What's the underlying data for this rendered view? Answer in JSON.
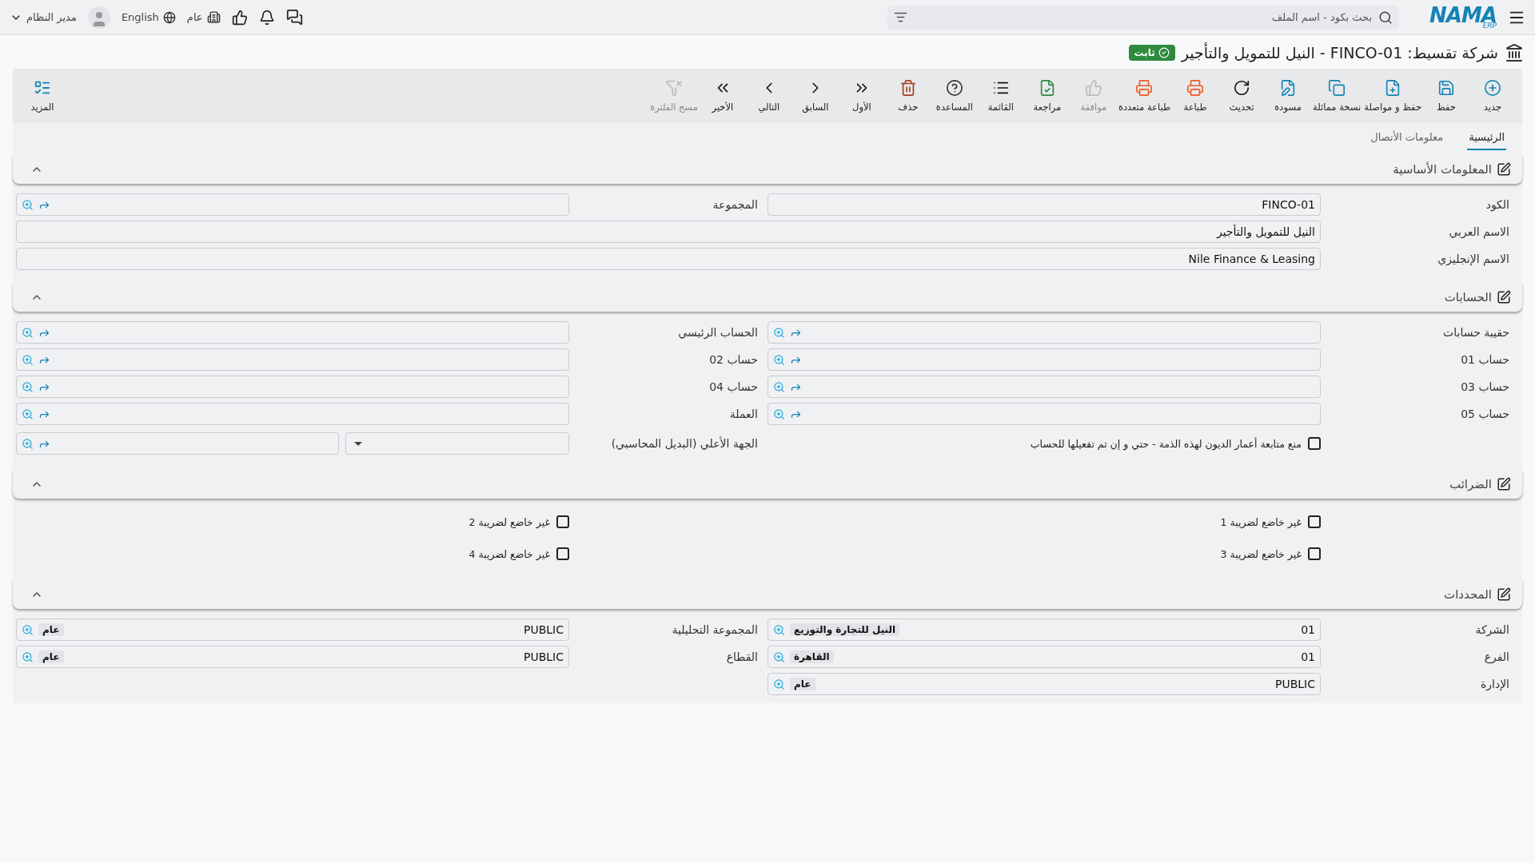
{
  "topbar": {
    "logo": {
      "name": "NAMA",
      "sub": "ERP"
    },
    "search": {
      "placeholder": "بحث بكود - اسم الملف"
    },
    "company": "عام",
    "language": "English",
    "user": "مدير النظام"
  },
  "title": {
    "text": "شركة تقسيط: FINCO-01 - النيل للتمويل والتأجير",
    "badge": "ثابت"
  },
  "toolbar": {
    "actions": [
      {
        "label": "جديد",
        "disabled": false
      },
      {
        "label": "حفظ",
        "disabled": false
      },
      {
        "label": "حفظ و مواصلة",
        "disabled": false
      },
      {
        "label": "نسخة مماثلة",
        "disabled": false
      },
      {
        "label": "مسودة",
        "disabled": false
      },
      {
        "label": "تحديث",
        "disabled": false
      },
      {
        "label": "طباعة",
        "disabled": false
      },
      {
        "label": "طباعة متعددة",
        "disabled": false
      },
      {
        "label": "موافقة",
        "disabled": true
      },
      {
        "label": "مراجعة",
        "disabled": false
      },
      {
        "label": "القائمة",
        "disabled": false
      },
      {
        "label": "المساعدة",
        "disabled": false
      },
      {
        "label": "حذف",
        "disabled": false
      },
      {
        "label": "الأول",
        "disabled": false
      },
      {
        "label": "السابق",
        "disabled": false
      },
      {
        "label": "التالي",
        "disabled": false
      },
      {
        "label": "الأخير",
        "disabled": false
      },
      {
        "label": "مسح الفلترة",
        "disabled": true
      }
    ],
    "more": "المزيد"
  },
  "tabs": [
    {
      "label": "الرئيسية",
      "selected": true
    },
    {
      "label": "معلومات الأتصال",
      "selected": false
    }
  ],
  "sections": [
    {
      "title": "المعلومات الأساسية",
      "expanded": true,
      "fields": [
        {
          "kind": "text",
          "label": "الكود",
          "value": "FINCO-01"
        },
        {
          "kind": "lookup",
          "label": "المجموعة"
        },
        {
          "kind": "wide",
          "label": "الاسم العربي",
          "value": "النيل للتمويل والتأجير"
        },
        {
          "kind": "wide",
          "label": "الاسم الإنجليزي",
          "value": "Nile Finance & Leasing"
        }
      ]
    },
    {
      "title": "الحسابات",
      "expanded": true,
      "fields": [
        {
          "kind": "lookup",
          "label": "حقيبة حسابات"
        },
        {
          "kind": "lookup",
          "label": "الحساب الرئيسي"
        },
        {
          "kind": "lookup",
          "label": "حساب 01"
        },
        {
          "kind": "lookup",
          "label": "حساب 02"
        },
        {
          "kind": "lookup",
          "label": "حساب 03"
        },
        {
          "kind": "lookup",
          "label": "حساب 04"
        },
        {
          "kind": "lookup",
          "label": "حساب 05"
        },
        {
          "kind": "lookup",
          "label": "العملة"
        },
        {
          "kind": "checkbox",
          "label": "منع متابعة أعمار الديون لهذه الذمة - حتي و إن تم تفعيلها للحساب",
          "checked": false
        },
        {
          "kind": "select-lookup",
          "label": "الجهة الأعلي (البديل المحاسبي)"
        }
      ]
    },
    {
      "title": "الضرائب",
      "expanded": true,
      "fields": [
        {
          "kind": "checkbox",
          "label": "غير خاضع لضريبة 1",
          "checked": false
        },
        {
          "kind": "checkbox",
          "label": "غير خاضع لضريبة 2",
          "checked": false
        },
        {
          "kind": "checkbox",
          "label": "غير خاضع لضريبة 3",
          "checked": false
        },
        {
          "kind": "checkbox",
          "label": "غير خاضع لضريبة 4",
          "checked": false
        }
      ]
    },
    {
      "title": "المحددات",
      "expanded": true,
      "fields": [
        {
          "kind": "code-lookup",
          "label": "الشركة",
          "value": "01",
          "tag": "النيل للتجارة والتوزيع"
        },
        {
          "kind": "code-lookup",
          "label": "المجموعة التحليلية",
          "value": "PUBLIC",
          "tag": "عام"
        },
        {
          "kind": "code-lookup",
          "label": "الفرع",
          "value": "01",
          "tag": "القاهرة"
        },
        {
          "kind": "code-lookup",
          "label": "القطاع",
          "value": "PUBLIC",
          "tag": "عام"
        },
        {
          "kind": "code-lookup",
          "label": "الإدارة",
          "value": "PUBLIC",
          "tag": "عام"
        }
      ]
    }
  ]
}
